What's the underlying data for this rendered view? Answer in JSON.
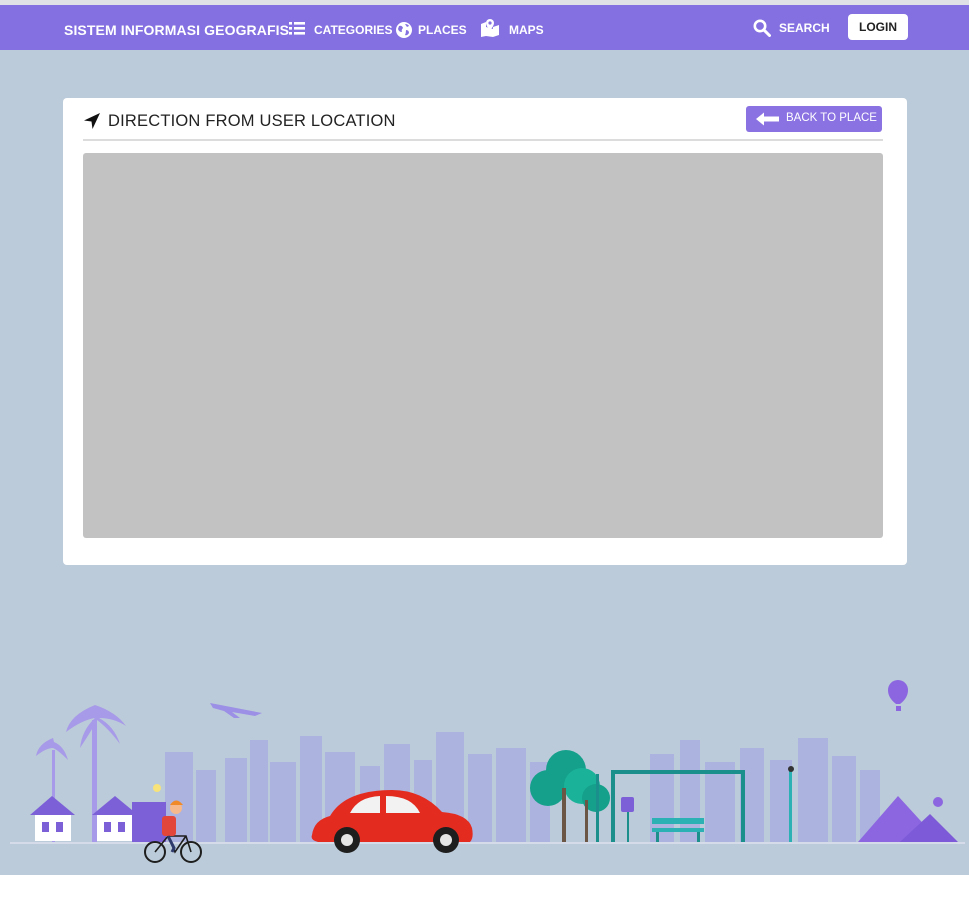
{
  "navbar": {
    "brand": "SISTEM INFORMASI GEOGRAFIS",
    "items": [
      {
        "label": "CATEGORIES",
        "icon": "list-icon"
      },
      {
        "label": "PLACES",
        "icon": "globe-icon"
      },
      {
        "label": "MAPS",
        "icon": "map-marker-icon"
      }
    ],
    "search_label": "SEARCH",
    "login_label": "LOGIN",
    "color": "#8470e0"
  },
  "card": {
    "title": "DIRECTION FROM USER LOCATION",
    "title_icon": "location-arrow-icon",
    "back_label": "BACK TO PLACE",
    "back_icon": "arrow-left-icon"
  },
  "colors": {
    "page_background": "#bccbd9",
    "accent": "#8b72e2",
    "map_placeholder": "#c2c2c2"
  }
}
